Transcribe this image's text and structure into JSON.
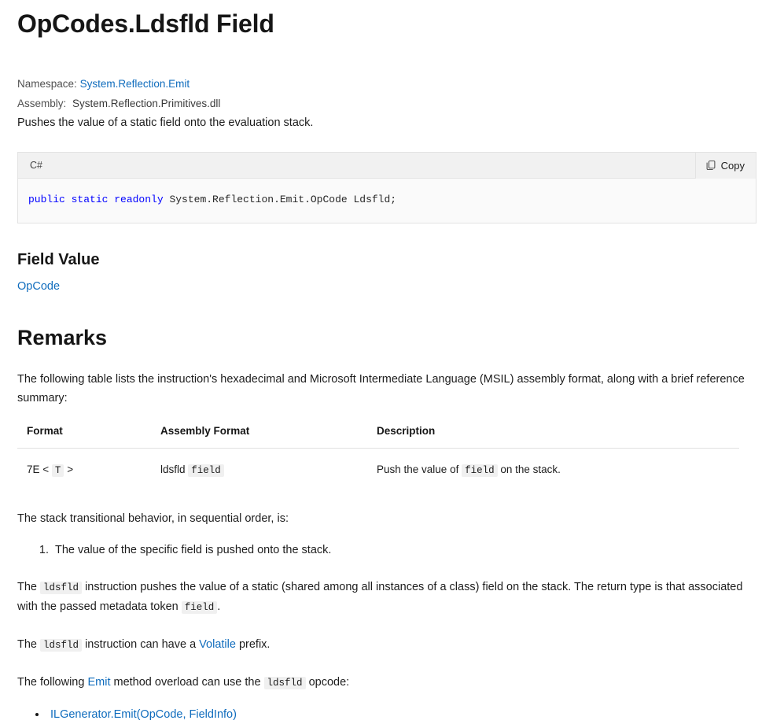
{
  "title": "OpCodes.Ldsfld Field",
  "meta": {
    "namespace_label": "Namespace:",
    "namespace_value": "System.Reflection.Emit",
    "assembly_label": "Assembly:",
    "assembly_value": "System.Reflection.Primitives.dll"
  },
  "summary": "Pushes the value of a static field onto the evaluation stack.",
  "code": {
    "language": "C#",
    "copy_label": "Copy",
    "copy_icon": "copy-icon",
    "keywords": "public static readonly",
    "declaration": " System.Reflection.Emit.OpCode Ldsfld;"
  },
  "field_value": {
    "heading": "Field Value",
    "type": "OpCode"
  },
  "remarks": {
    "heading": "Remarks",
    "intro": "The following table lists the instruction's hexadecimal and Microsoft Intermediate Language (MSIL) assembly format, along with a brief reference summary:",
    "table": {
      "headers": [
        "Format",
        "Assembly Format",
        "Description"
      ],
      "rows": [
        {
          "format_prefix": "7E <",
          "format_code": "T",
          "format_suffix": ">",
          "asm_text": "ldsfld",
          "asm_code": "field",
          "desc_prefix": "Push the value of",
          "desc_code": "field",
          "desc_suffix": "on the stack."
        }
      ]
    },
    "stack_intro": "The stack transitional behavior, in sequential order, is:",
    "steps": [
      "The value of the specific field is pushed onto the stack."
    ],
    "para_static": {
      "before": "The",
      "code1": "ldsfld",
      "middle": "instruction pushes the value of a static (shared among all instances of a class) field on the stack. The return type is that associated with the passed metadata token",
      "code2": "field",
      "after": "."
    },
    "para_volatile": {
      "before": "The",
      "code1": "ldsfld",
      "middle": "instruction can have a",
      "link": "Volatile",
      "after": "prefix."
    },
    "para_emit": {
      "before": "The following",
      "link": "Emit",
      "middle": "method overload can use the",
      "code1": "ldsfld",
      "after": "opcode:"
    },
    "overloads": [
      "ILGenerator.Emit(OpCode, FieldInfo)"
    ]
  }
}
